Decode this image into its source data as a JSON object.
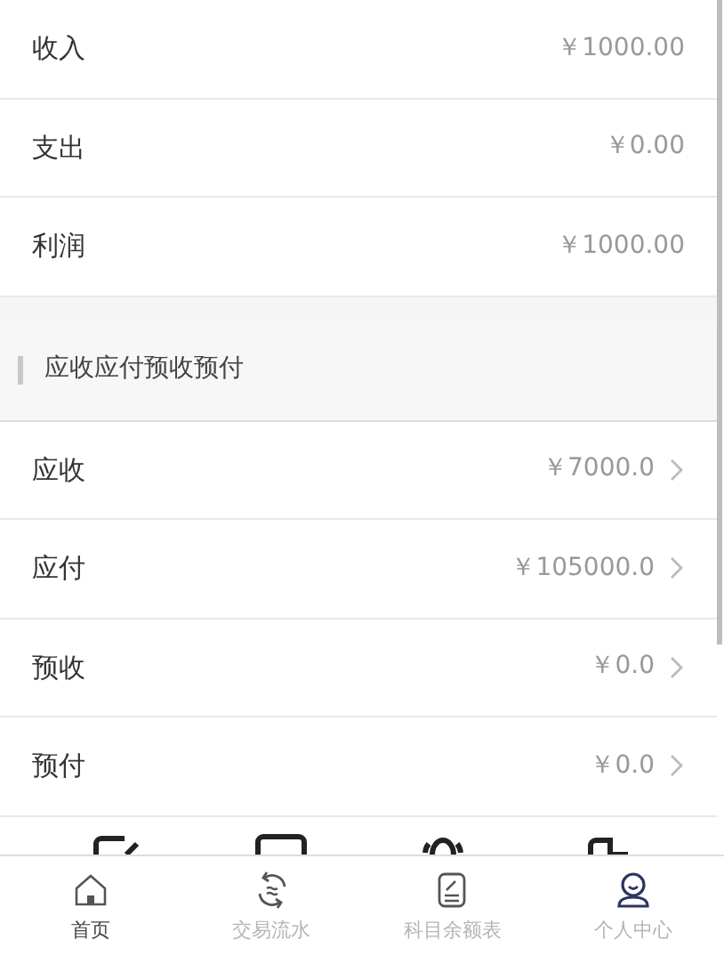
{
  "summary_rows": [
    {
      "label": "收入",
      "value": "￥1000.00",
      "chevron": false
    },
    {
      "label": "支出",
      "value": "￥0.00",
      "chevron": false
    },
    {
      "label": "利润",
      "value": "￥1000.00",
      "chevron": false
    }
  ],
  "section": {
    "title": "应收应付预收预付",
    "rows": [
      {
        "label": "应收",
        "value": "￥7000.0",
        "chevron": true
      },
      {
        "label": "应付",
        "value": "￥105000.0",
        "chevron": true
      },
      {
        "label": "预收",
        "value": "￥0.0",
        "chevron": true
      },
      {
        "label": "预付",
        "value": "￥0.0",
        "chevron": true
      }
    ]
  },
  "tab_bar": [
    {
      "kind": "home",
      "label": "首页",
      "selected": false,
      "label_active": true
    },
    {
      "kind": "transactions",
      "label": "交易流水",
      "selected": false,
      "label_active": false
    },
    {
      "kind": "ledger",
      "label": "科目余额表",
      "selected": false,
      "label_active": false
    },
    {
      "kind": "profile",
      "label": "个人中心",
      "selected": true,
      "label_active": false
    }
  ]
}
